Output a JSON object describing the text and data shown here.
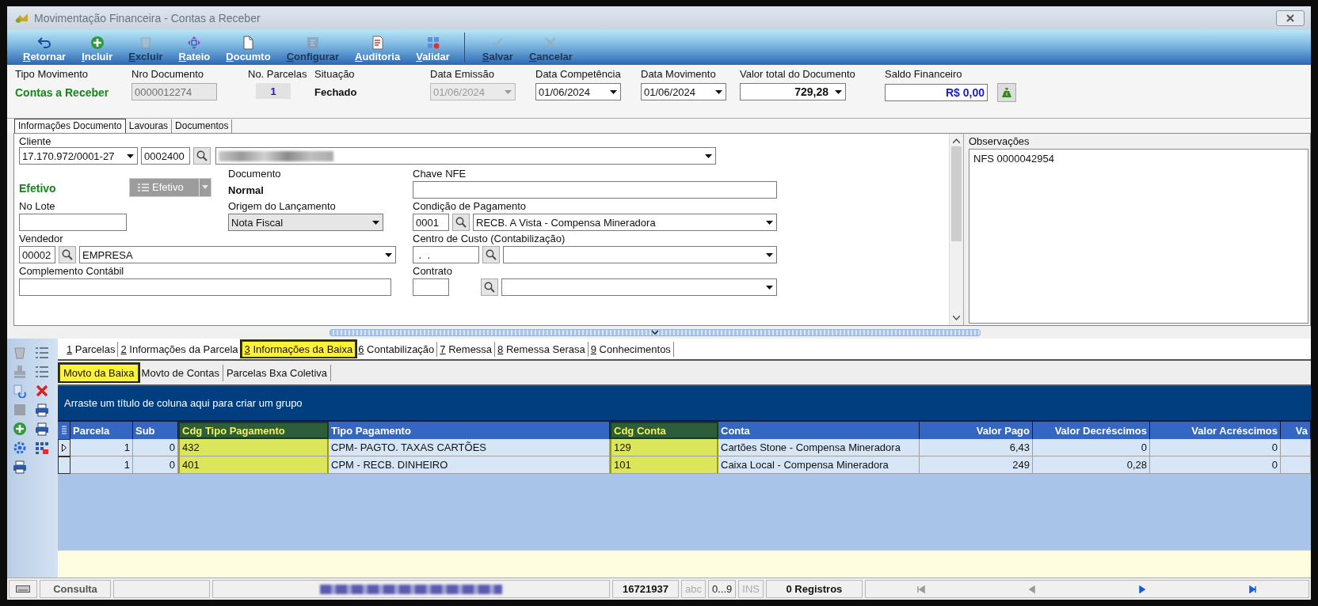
{
  "window": {
    "title": "Movimentação Financeira - Contas a Receber"
  },
  "toolbar": [
    {
      "label": "Retornar",
      "disabled": false
    },
    {
      "label": "Incluir",
      "disabled": false
    },
    {
      "label": "Excluir",
      "disabled": true
    },
    {
      "label": "Rateio",
      "disabled": false
    },
    {
      "label": "Documto",
      "disabled": false
    },
    {
      "label": "Configurar",
      "disabled": true
    },
    {
      "label": "Auditoria",
      "disabled": false
    },
    {
      "label": "Validar",
      "disabled": false
    },
    {
      "label": "Salvar",
      "disabled": true
    },
    {
      "label": "Cancelar",
      "disabled": true
    }
  ],
  "header": {
    "tipo_movimento": {
      "label": "Tipo Movimento",
      "value": "Contas a Receber"
    },
    "nro_documento": {
      "label": "Nro Documento",
      "value": "0000012274",
      "disabled": true
    },
    "no_parcelas": {
      "label": "No. Parcelas",
      "value": "1"
    },
    "situacao": {
      "label": "Situação",
      "value": "Fechado"
    },
    "data_emissao": {
      "label": "Data Emissão",
      "value": "01/06/2024",
      "disabled": true
    },
    "data_competencia": {
      "label": "Data Competência",
      "value": "01/06/2024",
      "disabled": false
    },
    "data_movimento": {
      "label": "Data Movimento",
      "value": "01/06/2024",
      "disabled": false
    },
    "valor_total": {
      "label": "Valor total do Documento",
      "value": "729,28"
    },
    "saldo_financeiro": {
      "label": "Saldo Financeiro",
      "value": "R$ 0,00"
    }
  },
  "doc_tabs": [
    {
      "label": "Informações Documento",
      "selected": true
    },
    {
      "label": "Lavouras",
      "selected": false
    },
    {
      "label": "Documentos",
      "selected": false
    }
  ],
  "form": {
    "cliente": {
      "label": "Cliente",
      "cnpj": "17.170.972/0001-27",
      "codigo": "0002400"
    },
    "status": {
      "value": "Efetivo",
      "button": "Efetivo",
      "disabled": true
    },
    "documento": {
      "label": "Documento",
      "value": "Normal"
    },
    "chave_nfe": {
      "label": "Chave NFE"
    },
    "no_lote": {
      "label": "No Lote"
    },
    "origem": {
      "label": "Origem do Lançamento",
      "value": "Nota Fiscal"
    },
    "condicao": {
      "label": "Condição de Pagamento",
      "codigo": "0001",
      "value": "RECB. A Vista - Compensa Mineradora"
    },
    "vendedor": {
      "label": "Vendedor",
      "codigo": "00002",
      "value": "EMPRESA"
    },
    "centro_custo": {
      "label": "Centro de Custo (Contabilização)",
      "codigo": " .  . "
    },
    "complemento": {
      "label": "Complemento Contábil"
    },
    "contrato": {
      "label": "Contrato"
    }
  },
  "observacoes": {
    "label": "Observações",
    "value": "NFS 0000042954"
  },
  "detail_tabs": [
    {
      "accel": "1",
      "label": "Parcelas",
      "selected": false,
      "highlighted": false
    },
    {
      "accel": "2",
      "label": "Informações da Parcela",
      "selected": false,
      "highlighted": false
    },
    {
      "accel": "3",
      "label": "Informações da Baixa",
      "selected": true,
      "highlighted": true
    },
    {
      "accel": "6",
      "label": "Contabilização",
      "selected": false,
      "highlighted": false
    },
    {
      "accel": "7",
      "label": "Remessa",
      "selected": false,
      "highlighted": false
    },
    {
      "accel": "8",
      "label": "Remessa Serasa",
      "selected": false,
      "highlighted": false
    },
    {
      "accel": "9",
      "label": "Conhecimentos",
      "selected": false,
      "highlighted": false
    }
  ],
  "sub_tabs": [
    {
      "label": "Movto da Baixa",
      "selected": true,
      "highlighted": true
    },
    {
      "label": "Movto de Contas",
      "selected": false,
      "highlighted": false
    },
    {
      "label": "Parcelas Bxa Coletiva",
      "selected": false,
      "highlighted": false
    }
  ],
  "grid": {
    "group_hint": "Arraste um título de coluna aqui para criar um grupo",
    "columns": [
      {
        "label": "Parcela",
        "kind": "number",
        "highlighted": false
      },
      {
        "label": "Sub",
        "kind": "number",
        "highlighted": false
      },
      {
        "label": "Cdg Tipo Pagamento",
        "kind": "text",
        "highlighted": true
      },
      {
        "label": "Tipo Pagamento",
        "kind": "text",
        "highlighted": false
      },
      {
        "label": "Cdg Conta",
        "kind": "text",
        "highlighted": true
      },
      {
        "label": "Conta",
        "kind": "text",
        "highlighted": false
      },
      {
        "label": "Valor Pago",
        "kind": "money",
        "highlighted": false
      },
      {
        "label": "Valor Decréscimos",
        "kind": "money",
        "highlighted": false
      },
      {
        "label": "Valor Acréscimos",
        "kind": "money",
        "highlighted": false
      },
      {
        "label": "Va",
        "kind": "money",
        "highlighted": false
      }
    ],
    "rows": [
      {
        "current": true,
        "cells": [
          "1",
          "0",
          "432",
          "CPM- PAGTO. TAXAS CARTÕES",
          "129",
          "Cartões Stone - Compensa Mineradora",
          "6,43",
          "0",
          "0"
        ]
      },
      {
        "current": false,
        "cells": [
          "1",
          "0",
          "401",
          "CPM - RECB. DINHEIRO",
          "101",
          "Caixa Local - Compensa Mineradora",
          "249",
          "0,28",
          "0"
        ]
      }
    ]
  },
  "status_bar": {
    "mode": "Consulta",
    "number": "16721937",
    "indicators": [
      {
        "label": "abc",
        "on": false
      },
      {
        "label": "0...9",
        "on": true
      },
      {
        "label": "INS",
        "on": false
      }
    ],
    "records": "0 Registros",
    "nav": [
      {
        "disabled": true
      },
      {
        "disabled": true
      },
      {
        "disabled": false
      },
      {
        "disabled": false
      }
    ]
  }
}
